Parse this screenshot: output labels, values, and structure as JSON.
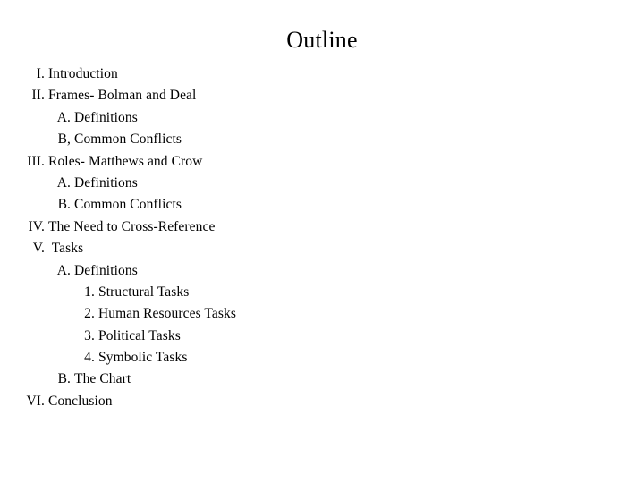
{
  "slide": {
    "title": "Outline",
    "background_color": "#ffffff",
    "text_color": "#000000",
    "outline": [
      {
        "marker": "I.",
        "text": "Introduction",
        "level": 1
      },
      {
        "marker": "II.",
        "text": "Frames- Bolman and Deal",
        "level": 1
      },
      {
        "marker": "A.",
        "text": "Definitions",
        "level": 2
      },
      {
        "marker": "B,",
        "text": "Common Conflicts",
        "level": 2
      },
      {
        "marker": "III.",
        "text": "Roles- Matthews and Crow",
        "level": 1
      },
      {
        "marker": "A.",
        "text": "Definitions",
        "level": 2
      },
      {
        "marker": "B.",
        "text": "Common Conflicts",
        "level": 2
      },
      {
        "marker": "IV.",
        "text": "The Need to Cross-Reference",
        "level": 1
      },
      {
        "marker": "V.",
        "text": " Tasks",
        "level": 1
      },
      {
        "marker": "A.",
        "text": "Definitions",
        "level": 2
      },
      {
        "marker": "1.",
        "text": "Structural Tasks",
        "level": 3
      },
      {
        "marker": "2.",
        "text": "Human Resources Tasks",
        "level": 3
      },
      {
        "marker": "3.",
        "text": "Political Tasks",
        "level": 3
      },
      {
        "marker": "4.",
        "text": "Symbolic Tasks",
        "level": 3
      },
      {
        "marker": "B.",
        "text": "The Chart",
        "level": 2
      },
      {
        "marker": "VI.",
        "text": "Conclusion",
        "level": 1
      }
    ]
  }
}
